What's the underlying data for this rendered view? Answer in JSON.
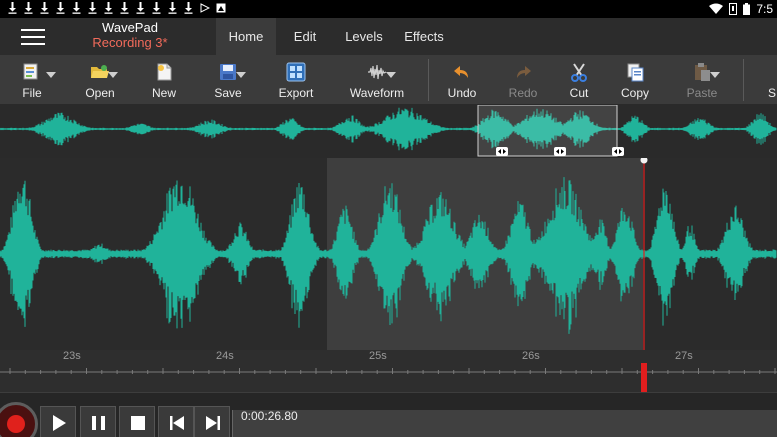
{
  "status_bar": {
    "download_count": 12,
    "time": "7:5"
  },
  "header": {
    "app_name": "WavePad",
    "document_name": "Recording 3*",
    "tabs": [
      {
        "label": "Home",
        "active": true
      },
      {
        "label": "Edit",
        "active": false
      },
      {
        "label": "Levels",
        "active": false
      },
      {
        "label": "Effects",
        "active": false
      }
    ]
  },
  "toolbar": {
    "file": "File",
    "open": "Open",
    "new": "New",
    "save": "Save",
    "export": "Export",
    "waveform": "Waveform",
    "undo": "Undo",
    "redo": "Redo",
    "cut": "Cut",
    "copy": "Copy",
    "paste": "Paste",
    "partial": "S"
  },
  "timeline": {
    "labels": [
      "23s",
      "24s",
      "25s",
      "26s",
      "27s"
    ]
  },
  "transport": {
    "current_time": "0:00:26.80"
  },
  "colors": {
    "waveform": "#20b39a",
    "selection": "#3e3e3e",
    "playhead": "#e01e1e",
    "record": "#e0211c",
    "document_title": "#f26b5b"
  }
}
